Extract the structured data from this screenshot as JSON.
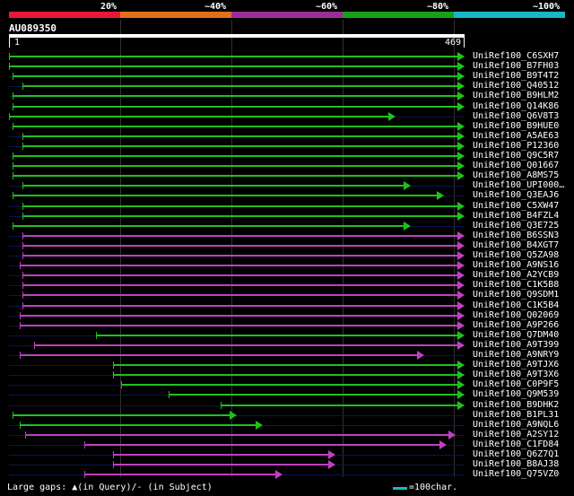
{
  "scale": {
    "labels": [
      "20%",
      "~40%",
      "~60%",
      "~80%",
      "~100%"
    ],
    "colors": [
      "#e8183a",
      "#e0701c",
      "#9c2c9c",
      "#18a018",
      "#1ab6c8"
    ]
  },
  "query": {
    "name": "AU089350",
    "start": "1",
    "end": "469",
    "length": 469
  },
  "legend": {
    "text": "Large gaps: ▲(in Query)/- (in Subject)",
    "unit": "=100char."
  },
  "colors": {
    "green": "#20c020",
    "magenta": "#c040c0",
    "track": "#0c1450"
  },
  "hits": [
    {
      "name": "UniRef100_C6SXH7",
      "from": 1,
      "to": 469,
      "color": "green"
    },
    {
      "name": "UniRef100_B7FH03",
      "from": 1,
      "to": 469,
      "color": "green"
    },
    {
      "name": "UniRef100_B9T4T2",
      "from": 5,
      "to": 469,
      "color": "green"
    },
    {
      "name": "UniRef100_Q40512",
      "from": 15,
      "to": 469,
      "color": "green"
    },
    {
      "name": "UniRef100_B9HLM2",
      "from": 5,
      "to": 469,
      "color": "green"
    },
    {
      "name": "UniRef100_Q14K86",
      "from": 5,
      "to": 469,
      "color": "green"
    },
    {
      "name": "UniRef100_Q6V8T3",
      "from": 1,
      "to": 398,
      "color": "green"
    },
    {
      "name": "UniRef100_B9HUE0",
      "from": 5,
      "to": 469,
      "color": "green"
    },
    {
      "name": "UniRef100_A5AE63",
      "from": 15,
      "to": 469,
      "color": "green"
    },
    {
      "name": "UniRef100_P12360",
      "from": 15,
      "to": 469,
      "color": "green"
    },
    {
      "name": "UniRef100_Q9C5R7",
      "from": 5,
      "to": 469,
      "color": "green"
    },
    {
      "name": "UniRef100_Q01667",
      "from": 5,
      "to": 469,
      "color": "green"
    },
    {
      "name": "UniRef100_A8MS75",
      "from": 5,
      "to": 469,
      "color": "green"
    },
    {
      "name": "UniRef100_UPI000…",
      "from": 15,
      "to": 414,
      "color": "green"
    },
    {
      "name": "UniRef100_Q3EAJ6",
      "from": 5,
      "to": 448,
      "color": "green"
    },
    {
      "name": "UniRef100_C5XW47",
      "from": 15,
      "to": 469,
      "color": "green"
    },
    {
      "name": "UniRef100_B4FZL4",
      "from": 15,
      "to": 469,
      "color": "green"
    },
    {
      "name": "UniRef100_Q3E725",
      "from": 5,
      "to": 414,
      "color": "green"
    },
    {
      "name": "UniRef100_B6SSN3",
      "from": 15,
      "to": 469,
      "color": "magenta"
    },
    {
      "name": "UniRef100_B4XGT7",
      "from": 15,
      "to": 469,
      "color": "magenta"
    },
    {
      "name": "UniRef100_Q5ZA98",
      "from": 15,
      "to": 469,
      "color": "magenta"
    },
    {
      "name": "UniRef100_A9NS16",
      "from": 12,
      "to": 469,
      "color": "magenta"
    },
    {
      "name": "UniRef100_A2YCB9",
      "from": 15,
      "to": 469,
      "color": "magenta"
    },
    {
      "name": "UniRef100_C1K5B8",
      "from": 15,
      "to": 469,
      "color": "magenta"
    },
    {
      "name": "UniRef100_Q9SDM1",
      "from": 15,
      "to": 469,
      "color": "magenta"
    },
    {
      "name": "UniRef100_C1K5B4",
      "from": 15,
      "to": 469,
      "color": "magenta"
    },
    {
      "name": "UniRef100_Q02069",
      "from": 12,
      "to": 469,
      "color": "magenta"
    },
    {
      "name": "UniRef100_A9P266",
      "from": 12,
      "to": 469,
      "color": "magenta"
    },
    {
      "name": "UniRef100_Q7DM40",
      "from": 90,
      "to": 469,
      "color": "green"
    },
    {
      "name": "UniRef100_A9T399",
      "from": 27,
      "to": 469,
      "color": "magenta"
    },
    {
      "name": "UniRef100_A9NRY9",
      "from": 12,
      "to": 428,
      "color": "magenta"
    },
    {
      "name": "UniRef100_A9TJX6",
      "from": 108,
      "to": 469,
      "color": "green"
    },
    {
      "name": "UniRef100_A9T3X6",
      "from": 108,
      "to": 469,
      "color": "green"
    },
    {
      "name": "UniRef100_C0P9F5",
      "from": 116,
      "to": 469,
      "color": "green"
    },
    {
      "name": "UniRef100_Q9M539",
      "from": 165,
      "to": 469,
      "color": "green"
    },
    {
      "name": "UniRef100_B9DHK2",
      "from": 218,
      "to": 469,
      "color": "green"
    },
    {
      "name": "UniRef100_B1PL31",
      "from": 5,
      "to": 235,
      "color": "green"
    },
    {
      "name": "UniRef100_A9NQL6",
      "from": 12,
      "to": 262,
      "color": "green"
    },
    {
      "name": "UniRef100_A2SY12",
      "from": 18,
      "to": 460,
      "color": "magenta"
    },
    {
      "name": "UniRef100_C1FD84",
      "from": 78,
      "to": 451,
      "color": "magenta"
    },
    {
      "name": "UniRef100_Q6Z7Q1",
      "from": 108,
      "to": 336,
      "color": "magenta"
    },
    {
      "name": "UniRef100_B8AJ38",
      "from": 108,
      "to": 336,
      "color": "magenta"
    },
    {
      "name": "UniRef100_Q75VZ0",
      "from": 78,
      "to": 282,
      "color": "magenta"
    }
  ]
}
